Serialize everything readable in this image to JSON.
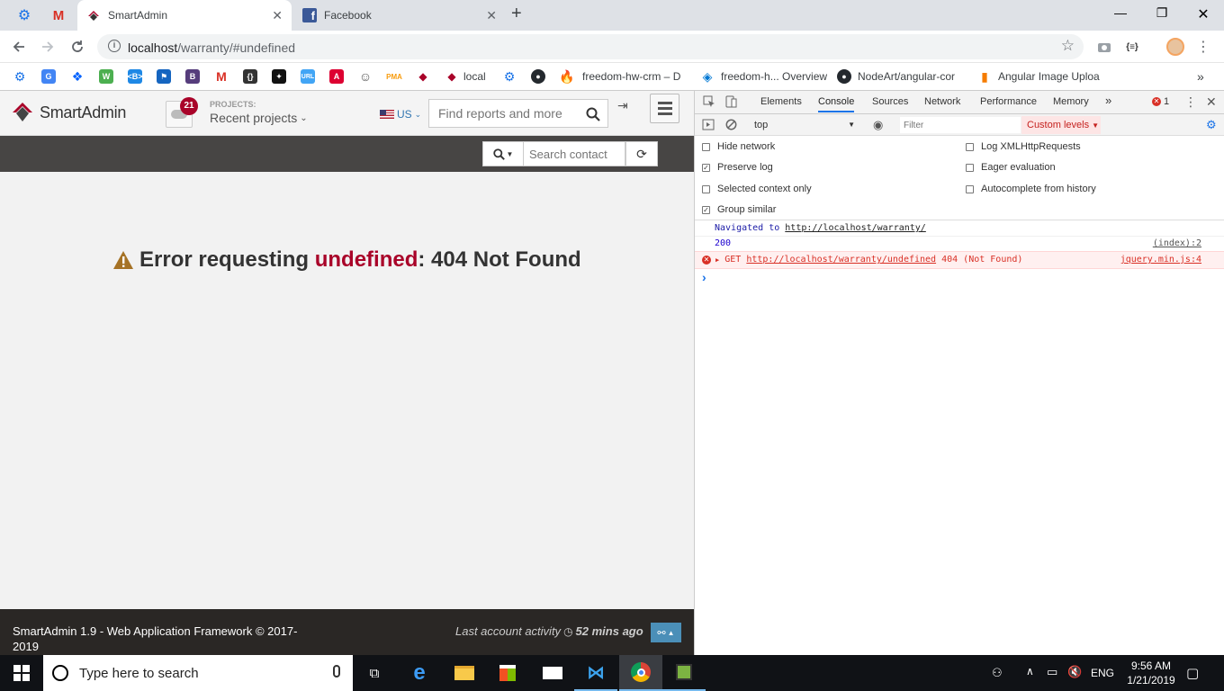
{
  "browser": {
    "tabs": [
      {
        "title": "SmartAdmin",
        "active": true
      },
      {
        "title": "Facebook",
        "active": false
      }
    ],
    "url_host": "localhost",
    "url_path": "/warranty/#undefined",
    "bookmarks": [
      {
        "icon": "gear-icon"
      },
      {
        "icon": "translate-icon"
      },
      {
        "icon": "dropbox-icon"
      },
      {
        "icon": "w3c-icon"
      },
      {
        "icon": "bootstrap-tag-icon"
      },
      {
        "icon": "flag-icon"
      },
      {
        "icon": "b-icon"
      },
      {
        "icon": "gmail-icon"
      },
      {
        "icon": "braces-icon"
      },
      {
        "icon": "star-icon"
      },
      {
        "icon": "url-icon"
      },
      {
        "icon": "angular-icon"
      },
      {
        "icon": "person-icon"
      },
      {
        "icon": "pma-icon"
      },
      {
        "icon": "smartadmin-icon"
      },
      {
        "label": "local",
        "icon": "smartadmin-icon"
      },
      {
        "icon": "chip-icon"
      },
      {
        "icon": "github-icon"
      },
      {
        "label": "freedom-hw-crm – D",
        "icon": "firebase-icon"
      },
      {
        "label": "freedom-h... Overview",
        "icon": "stack-icon"
      },
      {
        "label": "NodeArt/angular-cor",
        "icon": "github-icon"
      },
      {
        "label": "Angular Image Uploa",
        "icon": "bookmark-icon"
      }
    ],
    "more_bookmarks": "»"
  },
  "app": {
    "brand": "SmartAdmin",
    "notification_count": "21",
    "projects_label": "PROJECTS:",
    "projects_value": "Recent projects",
    "lang": "US",
    "search_placeholder": "Find reports and more",
    "contact_placeholder": "Search contact",
    "error": {
      "prefix": "Error requesting ",
      "highlight": "undefined",
      "suffix": ": 404 Not Found"
    },
    "footer": {
      "copyright": "SmartAdmin 1.9 - Web Application Framework © 2017-2019",
      "activity_prefix": "Last account activity",
      "activity_value": "52 mins ago"
    }
  },
  "devtools": {
    "tabs": [
      "Elements",
      "Console",
      "Sources",
      "Network",
      "Performance",
      "Memory"
    ],
    "active_tab": "Console",
    "more": "»",
    "error_count": "1",
    "context": "top",
    "filter_placeholder": "Filter",
    "levels": "Custom levels",
    "options": [
      {
        "label": "Hide network",
        "checked": false
      },
      {
        "label": "Log XMLHttpRequests",
        "checked": false
      },
      {
        "label": "Preserve log",
        "checked": true
      },
      {
        "label": "Eager evaluation",
        "checked": false
      },
      {
        "label": "Selected context only",
        "checked": false
      },
      {
        "label": "Autocomplete from history",
        "checked": false
      },
      {
        "label": "Group similar",
        "checked": true
      }
    ],
    "messages": {
      "nav_prefix": "Navigated to",
      "nav_url": "http://localhost/warranty/",
      "log_value": "200",
      "log_source": "(index):2",
      "err_method": "GET",
      "err_url": "http://localhost/warranty/undefined",
      "err_status": "404 (Not Found)",
      "err_source": "jquery.min.js:4",
      "prompt": "›"
    }
  },
  "taskbar": {
    "search_placeholder": "Type here to search",
    "lang": "ENG",
    "time": "9:56 AM",
    "date": "1/21/2019"
  },
  "colors": {
    "error_red": "#a90329",
    "devtools_error": "#d93026",
    "taskbar": "#101216"
  }
}
